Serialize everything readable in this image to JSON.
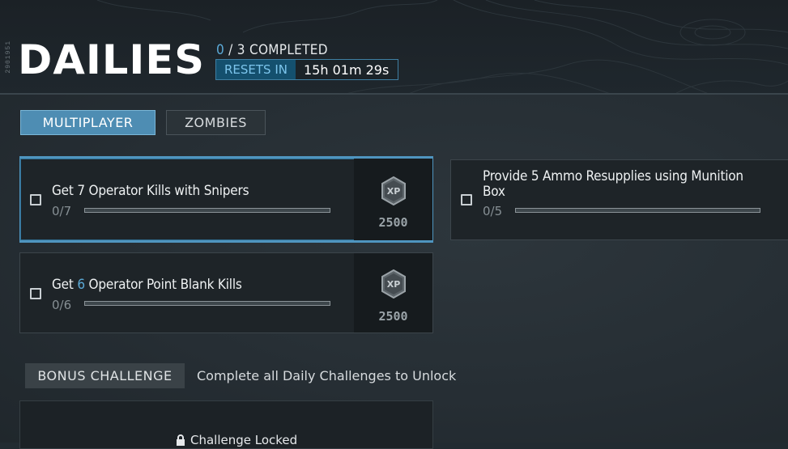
{
  "header": {
    "build_id": "2901951",
    "title": "DAILIES",
    "completed_count": "0",
    "completed_suffix": " / 3 COMPLETED",
    "resets_label": "RESETS IN",
    "resets_time": "15h 01m 29s"
  },
  "tabs": [
    {
      "label": "MULTIPLAYER",
      "active": true
    },
    {
      "label": "ZOMBIES",
      "active": false
    }
  ],
  "challenges": [
    {
      "title_pre": "Get 7 Operator Kills with Snipers",
      "progress_text": "0/7",
      "progress": 0,
      "xp": "2500",
      "selected": true
    },
    {
      "title_line1": "Provide 5 Ammo Resupplies using Munition",
      "title_line2": "Box",
      "progress_text": "0/5",
      "progress": 0
    },
    {
      "title_pre": "Get ",
      "title_hl": "6",
      "title_post": " Operator Point Blank Kills",
      "progress_text": "0/6",
      "progress": 0,
      "xp": "2500"
    }
  ],
  "bonus": {
    "label": "BONUS CHALLENGE",
    "description": "Complete all Daily Challenges to Unlock",
    "locked_text": "Challenge Locked"
  },
  "icons": {
    "xp": "xp-badge-icon",
    "lock": "lock-icon"
  },
  "colors": {
    "accent": "#4e8db3",
    "highlight": "#5ba9d6",
    "background": "#222b31"
  }
}
